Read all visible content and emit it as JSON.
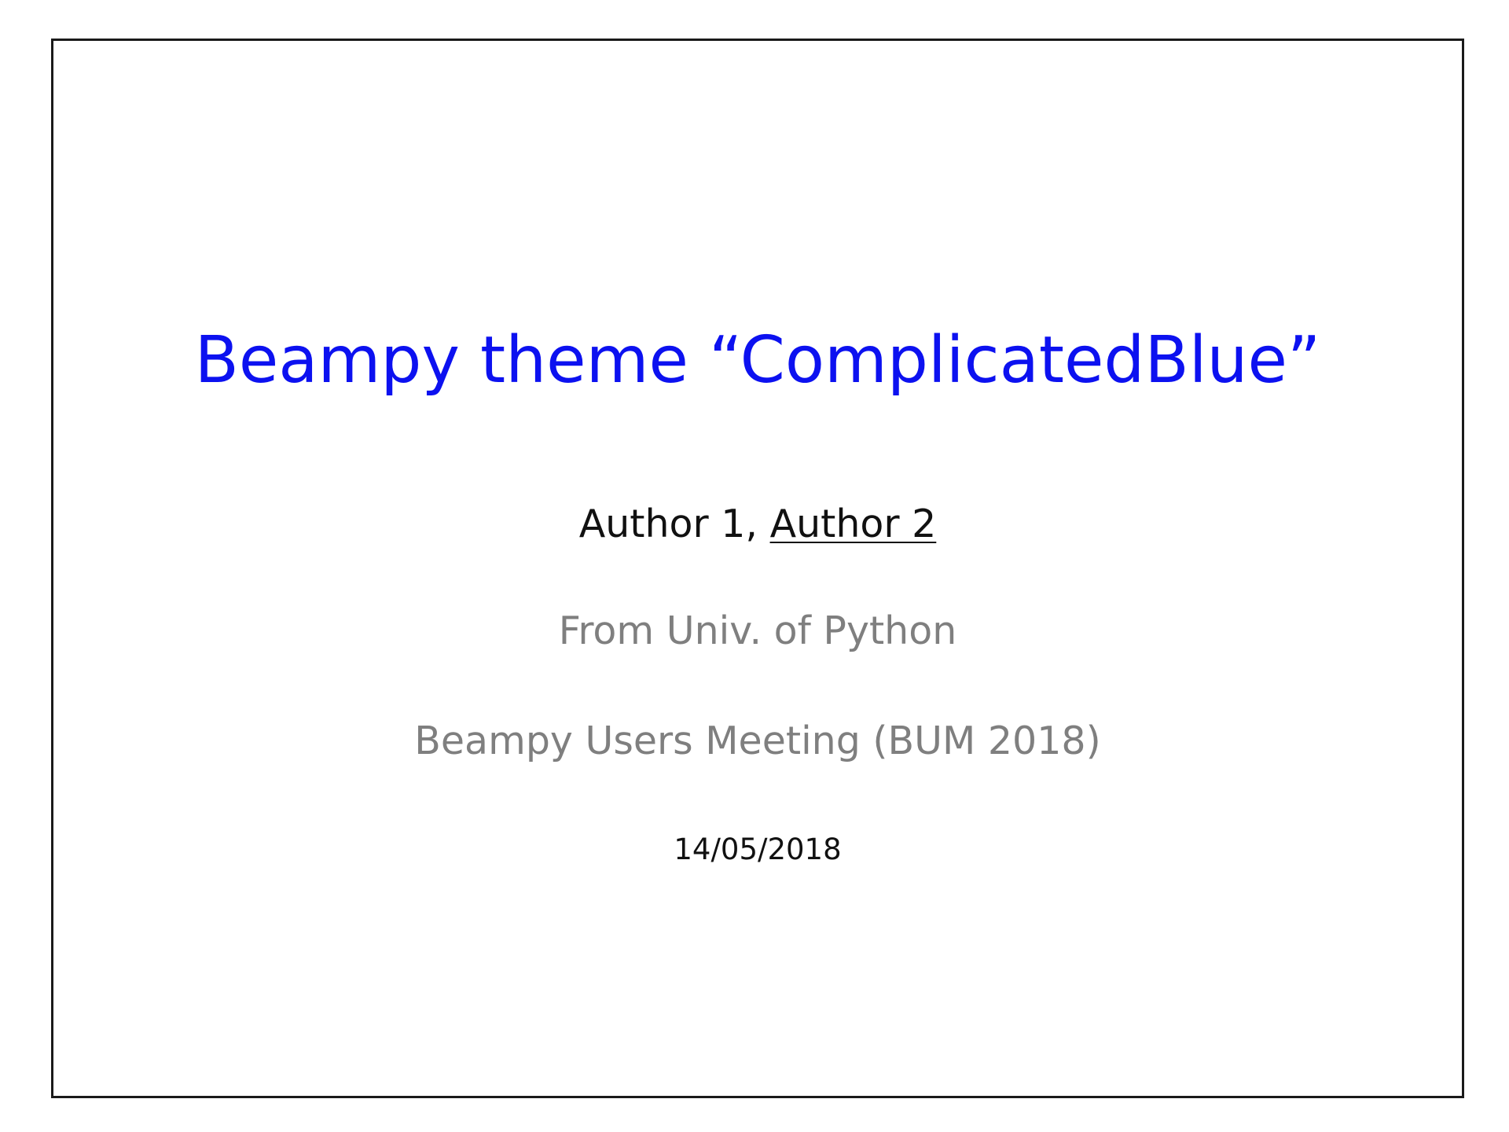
{
  "slide": {
    "title": "Beampy theme “ComplicatedBlue”",
    "authors": {
      "first": "Author 1,",
      "separator": " ",
      "second": "Author 2"
    },
    "affiliation": "From Univ. of Python",
    "meeting": "Beampy Users Meeting (BUM 2018)",
    "date": "14/05/2018"
  },
  "colors": {
    "title": "#0c11f0",
    "authors": "#111111",
    "muted": "#7f7f7f",
    "frame": "#1a1a1a"
  }
}
